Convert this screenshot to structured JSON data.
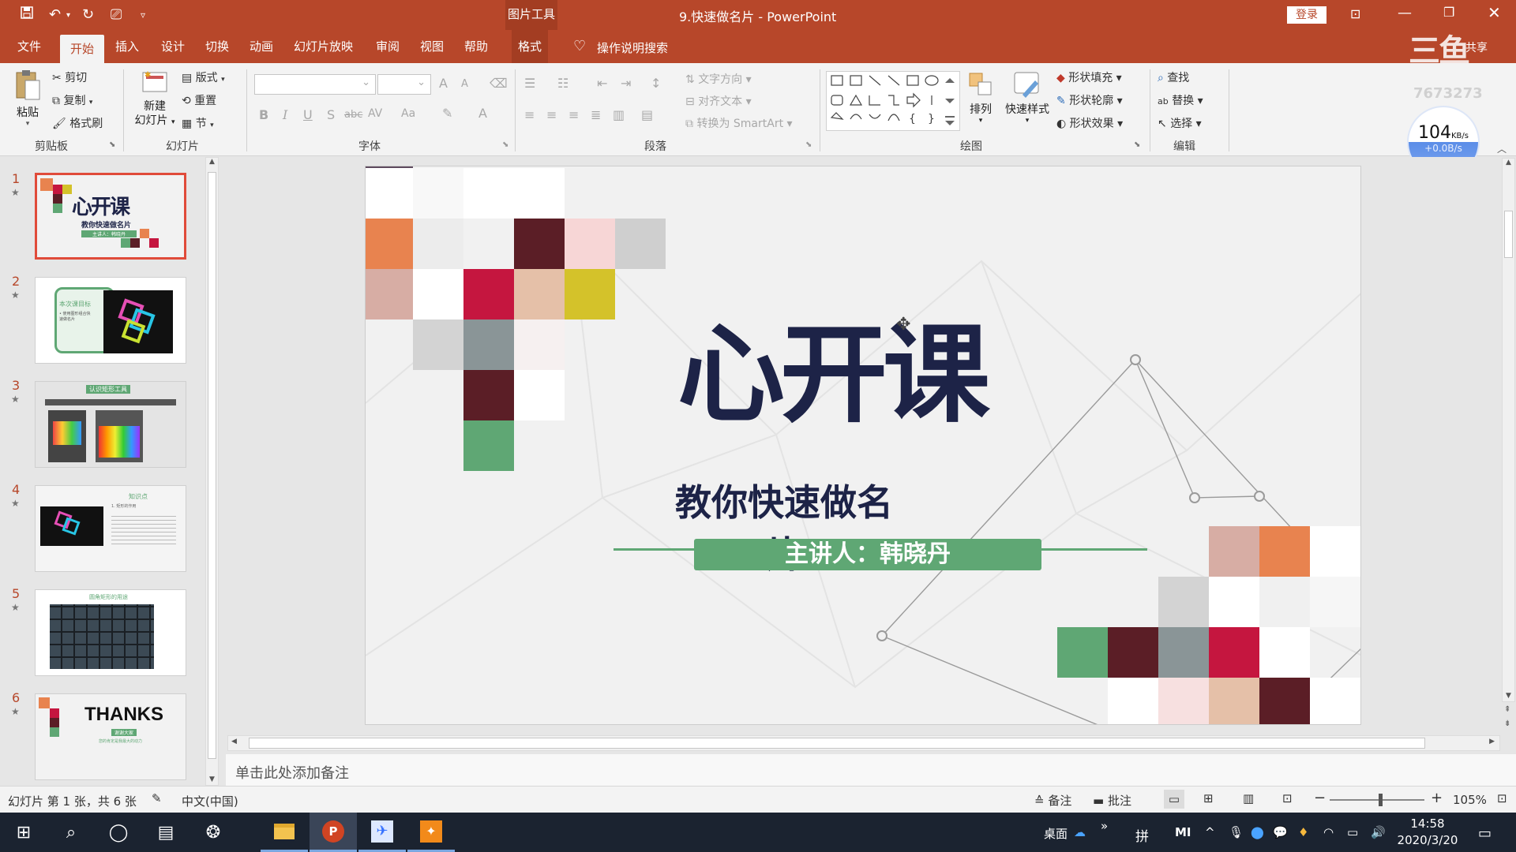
{
  "app": {
    "doc_title": "9.快速做名片  -  PowerPoint",
    "contextual_group": "图片工具",
    "login": "登录",
    "watermark_id": "7673273"
  },
  "tabs": [
    "文件",
    "开始",
    "插入",
    "设计",
    "切换",
    "动画",
    "幻灯片放映",
    "审阅",
    "视图",
    "帮助",
    "格式"
  ],
  "tab_active": "开始",
  "tell_me": "操作说明搜索",
  "share_label": "共享",
  "ribbon": {
    "clipboard": {
      "paste": "粘贴",
      "cut": "剪切",
      "copy": "复制",
      "format_painter": "格式刷",
      "label": "剪贴板"
    },
    "slides": {
      "new_slide": "新建",
      "new_slide2": "幻灯片",
      "layout": "版式",
      "reset": "重置",
      "section": "节",
      "label": "幻灯片"
    },
    "font": {
      "label": "字体",
      "bold": "B",
      "italic": "I",
      "underline": "U",
      "shadow": "S",
      "strike": "abc",
      "spacing": "AV",
      "case": "Aa",
      "grow": "A",
      "shrink": "A",
      "color": "A"
    },
    "paragraph": {
      "label": "段落",
      "text_direction": "文字方向",
      "align_text": "对齐文本",
      "smartart": "转换为 SmartArt"
    },
    "drawing": {
      "label": "绘图",
      "arrange": "排列",
      "quick_styles": "快速样式",
      "fill": "形状填充",
      "outline": "形状轮廓",
      "effects": "形状效果"
    },
    "editing": {
      "label": "编辑",
      "find": "查找",
      "replace": "替换",
      "select": "选择"
    }
  },
  "net_speed": {
    "value": "104",
    "unit": "KB/s",
    "up": "+0.0B/s"
  },
  "thumbnails": [
    {
      "num": "1",
      "caption": "心开课",
      "sub": "教你快速做名片",
      "speaker": "主讲人：韩晓丹"
    },
    {
      "num": "2",
      "caption": "本次课目标",
      "body": "• 使用图形组合快速做名片"
    },
    {
      "num": "3",
      "caption": "认识矩形工具"
    },
    {
      "num": "4",
      "caption": "知识点",
      "body": "1. 矩形的作用"
    },
    {
      "num": "5",
      "caption": "圆角矩形的用途"
    },
    {
      "num": "6",
      "caption": "THANKS",
      "sub": "谢谢大家",
      "speaker": "您的肯定是我最大的动力"
    }
  ],
  "slide": {
    "title": "心开课",
    "subtitle": "教你快速做名片",
    "speaker": "主讲人：韩晓丹"
  },
  "notes_placeholder": "单击此处添加备注",
  "status": {
    "slide_info": "幻灯片 第 1 张，共 6 张",
    "language": "中文(中国)",
    "notes": "备注",
    "comments": "批注",
    "zoom": "105%"
  },
  "taskbar": {
    "desktop_label": "桌面",
    "ime": "拼",
    "time": "14:58",
    "date": "2020/3/20"
  },
  "colors": {
    "accent": "#b7472a",
    "green": "#5fa774",
    "navy": "#1d2347"
  }
}
